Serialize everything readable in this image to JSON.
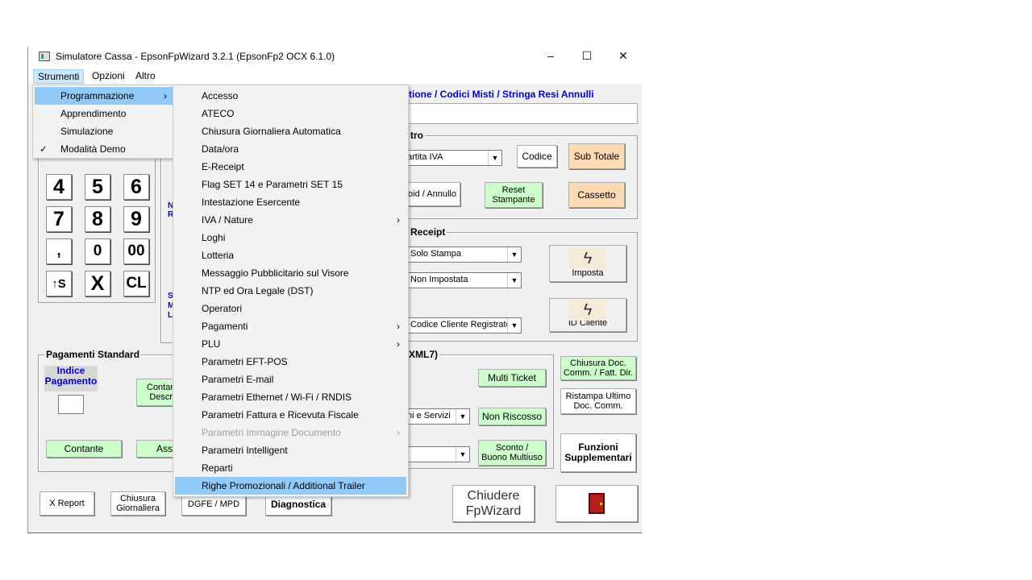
{
  "window": {
    "title": "Simulatore Cassa - EpsonFpWizard 3.2.1 (EpsonFp2 OCX 6.1.0)",
    "controls": {
      "minimize": "–",
      "maximize": "☐",
      "close": "✕"
    }
  },
  "menubar": {
    "items": [
      "Strumenti",
      "Opzioni",
      "Altro"
    ],
    "active": "Strumenti"
  },
  "strumenti_menu": {
    "items": [
      {
        "label": "Programmazione",
        "submenu": true,
        "highlighted": true
      },
      {
        "label": "Apprendimento"
      },
      {
        "label": "Simulazione"
      },
      {
        "label": "Modalità Demo",
        "checked": true
      }
    ],
    "check_glyph": "✓",
    "submenu_glyph": "›"
  },
  "programmazione_menu": {
    "items": [
      {
        "label": "Accesso"
      },
      {
        "label": "ATECO"
      },
      {
        "label": "Chiusura Giornaliera Automatica"
      },
      {
        "label": "Data/ora"
      },
      {
        "label": "E-Receipt"
      },
      {
        "label": "Flag SET 14 e Parametri SET 15"
      },
      {
        "label": "Intestazione Esercente"
      },
      {
        "label": "IVA / Nature",
        "submenu": true
      },
      {
        "label": "Loghi"
      },
      {
        "label": "Lotteria"
      },
      {
        "label": "Messaggio Pubblicitario sul Visore"
      },
      {
        "label": "NTP ed Ora Legale (DST)"
      },
      {
        "label": "Operatori"
      },
      {
        "label": "Pagamenti",
        "submenu": true
      },
      {
        "label": "PLU",
        "submenu": true
      },
      {
        "label": "Parametri EFT-POS"
      },
      {
        "label": "Parametri E-mail"
      },
      {
        "label": "Parametri Ethernet / Wi-Fi / RNDIS"
      },
      {
        "label": "Parametri Fattura e Ricevuta Fiscale"
      },
      {
        "label": "Parametri Immagine Documento",
        "submenu": true,
        "disabled": true
      },
      {
        "label": "Parametri Intelligent"
      },
      {
        "label": "Reparti"
      },
      {
        "label": "Righe Promozionali / Additional Trailer",
        "highlighted": true
      }
    ]
  },
  "header_strip": {
    "text": "tione / Codici Misti / Stringa Resi Annulli"
  },
  "keypad": {
    "rows": [
      [
        "4",
        "5",
        "6"
      ],
      [
        "7",
        "8",
        "9"
      ],
      [
        ",",
        "0",
        "00"
      ],
      [
        "↑S",
        "X",
        "CL"
      ]
    ]
  },
  "middle_panel": {
    "left_chars_1": [
      "N",
      "R"
    ],
    "left_chars_2": [
      "S",
      "M",
      "L"
    ]
  },
  "altro_group": {
    "title": "tro",
    "combo_value": "artita IVA",
    "codice": "Codice",
    "sub_totale": "Sub Totale",
    "void_annullo": "oid / Annullo",
    "reset_stampante": "Reset\nStampante",
    "cassetto": "Cassetto"
  },
  "ereceipt_group": {
    "title": "Receipt",
    "combo1": "Solo Stampa",
    "combo2": "Non Impostata",
    "combo3": "Codice Cliente Registrato",
    "imposta": "Imposta",
    "id_cliente": "ID Cliente"
  },
  "xml_group": {
    "title": "XML7)",
    "multi_ticket": "Multi Ticket",
    "combo_beni": "ni e Servizi",
    "non_riscosso": "Non Riscosso",
    "sconto": "Sconto /\nBuono Multiuso"
  },
  "right_buttons": {
    "chiusura_doc": "Chiusura Doc.\nComm. / Fatt. Dir.",
    "ristampa": "Ristampa Ultimo\nDoc. Comm.",
    "funzioni": "Funzioni\nSupplementari"
  },
  "pagamenti": {
    "title": "Pagamenti Standard",
    "indice": "Indice\nPagamento",
    "indice_value": "",
    "contante_desc": "Contan\nDescr",
    "contante": "Contante",
    "assegno": "Asse"
  },
  "bottom_buttons": {
    "x_report": "X Report",
    "chiusura_giornaliera": "Chiusura\nGiornaliera",
    "dgfe": "DGFE / MPD",
    "diagnostica": "Diagnostica",
    "chiudere": "Chiudere\nFpWizard"
  },
  "colors": {
    "highlight": "#91c9f7",
    "green": "#ccffcc",
    "peach": "#ffd9b3",
    "blue_text": "#0000cc"
  }
}
